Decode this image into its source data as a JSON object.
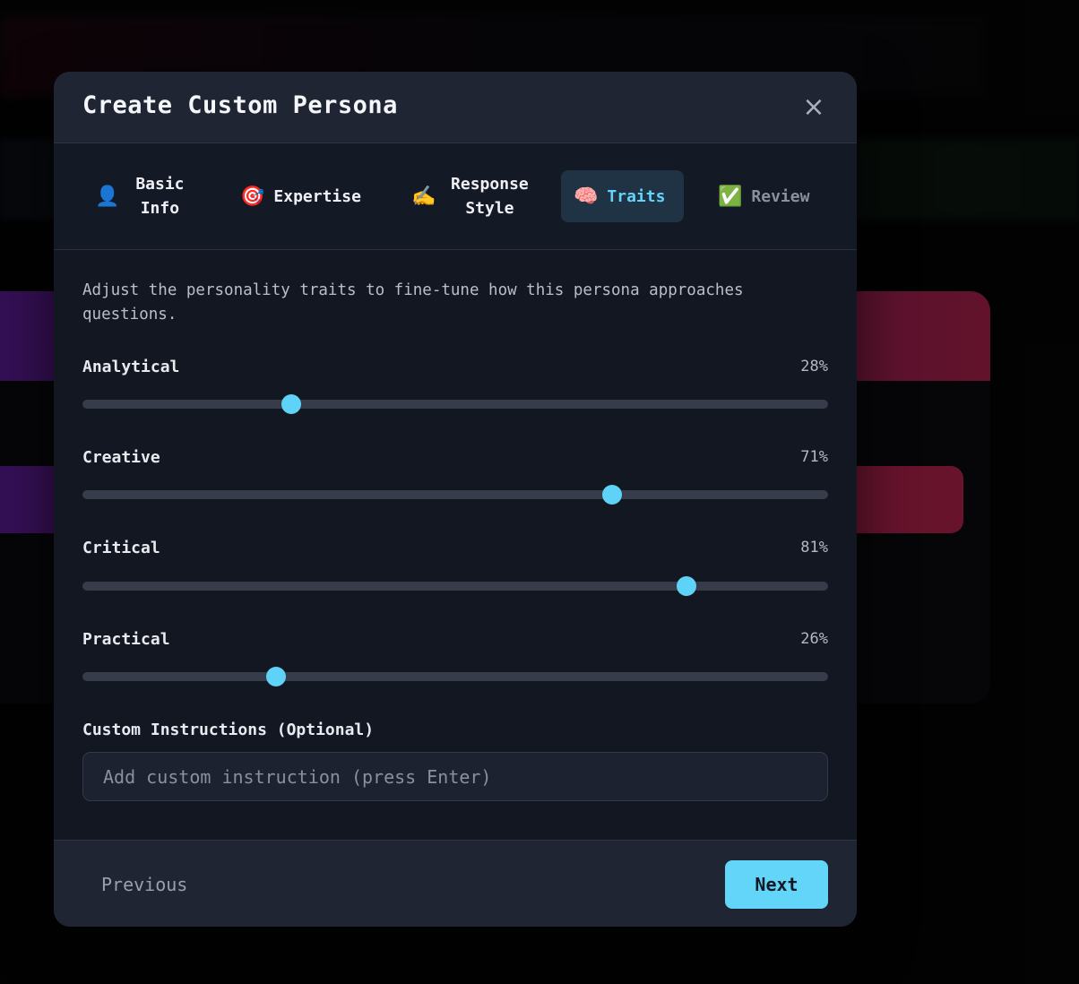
{
  "modal": {
    "title": "Create Custom Persona",
    "close_icon": "×"
  },
  "steps": [
    {
      "icon": "👤",
      "icon_name": "user-icon",
      "label": "Basic Info",
      "state": "done"
    },
    {
      "icon": "🎯",
      "icon_name": "target-icon",
      "label": "Expertise",
      "state": "done"
    },
    {
      "icon": "✍️",
      "icon_name": "writing-hand-icon",
      "label": "Response Style",
      "state": "done"
    },
    {
      "icon": "🧠",
      "icon_name": "brain-icon",
      "label": "Traits",
      "state": "active"
    },
    {
      "icon": "✅",
      "icon_name": "check-mark-icon",
      "label": "Review",
      "state": "upcoming"
    }
  ],
  "traits": {
    "description": "Adjust the personality traits to fine-tune how this persona approaches questions.",
    "items": [
      {
        "name": "Analytical",
        "value": 28,
        "value_label": "28%"
      },
      {
        "name": "Creative",
        "value": 71,
        "value_label": "71%"
      },
      {
        "name": "Critical",
        "value": 81,
        "value_label": "81%"
      },
      {
        "name": "Practical",
        "value": 26,
        "value_label": "26%"
      }
    ]
  },
  "custom_instructions": {
    "label": "Custom Instructions (Optional)",
    "placeholder": "Add custom instruction (press Enter)",
    "value": ""
  },
  "footer": {
    "previous_label": "Previous",
    "next_label": "Next"
  },
  "colors": {
    "accent": "#62d5f8",
    "modal_bg": "#131722",
    "header_bg": "#1f2533",
    "track": "#363c4a"
  }
}
